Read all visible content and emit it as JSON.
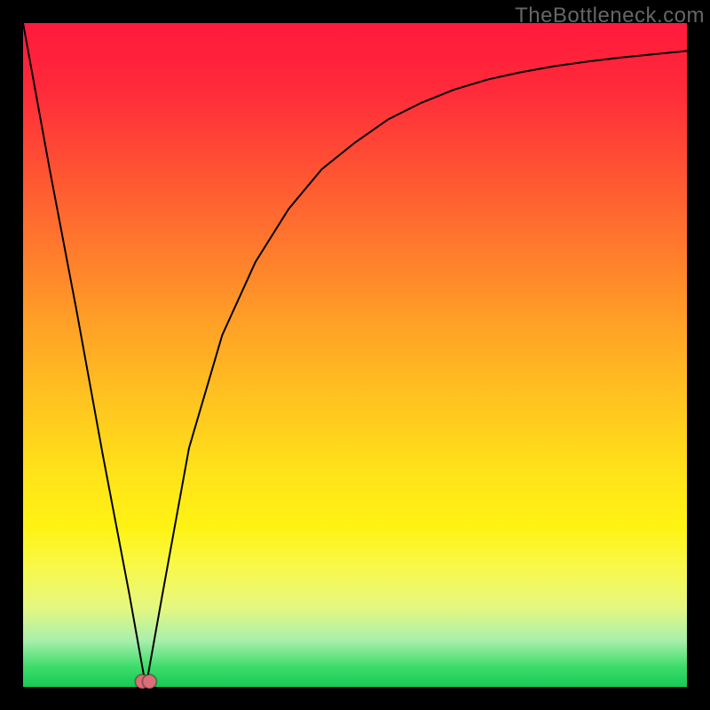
{
  "watermark": "TheBottleneck.com",
  "chart_data": {
    "type": "line",
    "title": "",
    "xlabel": "",
    "ylabel": "",
    "x": [
      0.0,
      0.04,
      0.08,
      0.12,
      0.16,
      0.185,
      0.21,
      0.25,
      0.3,
      0.35,
      0.4,
      0.45,
      0.5,
      0.55,
      0.6,
      0.65,
      0.7,
      0.75,
      0.8,
      0.85,
      0.9,
      0.95,
      1.0
    ],
    "values": [
      1.0,
      0.78,
      0.57,
      0.35,
      0.14,
      0.0,
      0.14,
      0.36,
      0.53,
      0.64,
      0.72,
      0.78,
      0.82,
      0.855,
      0.88,
      0.9,
      0.915,
      0.926,
      0.935,
      0.942,
      0.948,
      0.953,
      0.958
    ],
    "marker": {
      "x": 0.185,
      "y": 0.0
    },
    "xlim": [
      0,
      1
    ],
    "ylim": [
      0,
      1
    ],
    "grid": false
  },
  "colors": {
    "gradient_top": "#ff1a3c",
    "gradient_bottom": "#18c956",
    "marker": "#db6e77"
  }
}
